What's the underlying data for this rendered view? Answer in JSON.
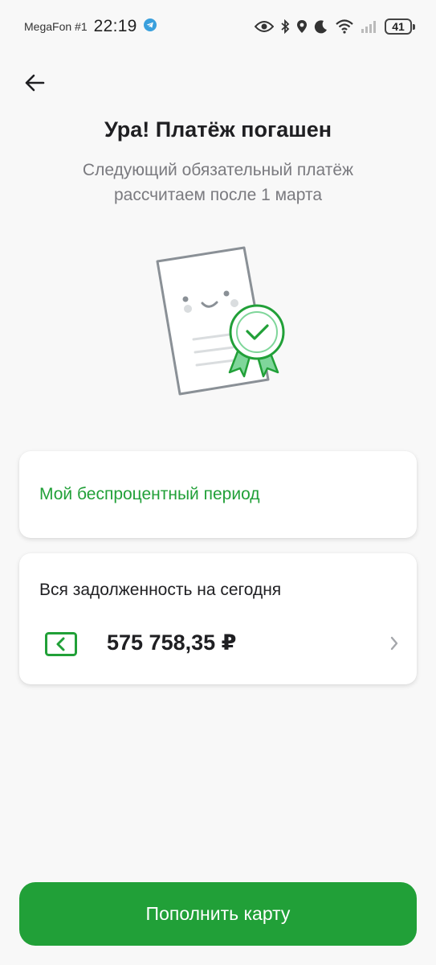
{
  "status_bar": {
    "carrier": "MegaFon #1",
    "time": "22:19",
    "battery": "41",
    "icons": [
      "telegram-icon",
      "eye-icon",
      "bluetooth-icon",
      "location-icon",
      "moon-icon",
      "wifi-icon",
      "signal-icon",
      "battery-icon"
    ]
  },
  "header": {
    "title": "Ура! Платёж погашен",
    "subtitle": "Следующий обязательный платёж рассчитаем после 1 марта"
  },
  "illustration": "document-with-badge",
  "period_card": {
    "label": "Мой беспроцентный период"
  },
  "debt_card": {
    "label": "Вся задолженность на сегодня",
    "amount": "575 758,35 ₽"
  },
  "actions": {
    "top_up_label": "Пополнить карту"
  },
  "colors": {
    "accent": "#21a038",
    "background": "#f8f8f8",
    "text_primary": "#1f1f22",
    "text_secondary": "#7a7a7f"
  }
}
